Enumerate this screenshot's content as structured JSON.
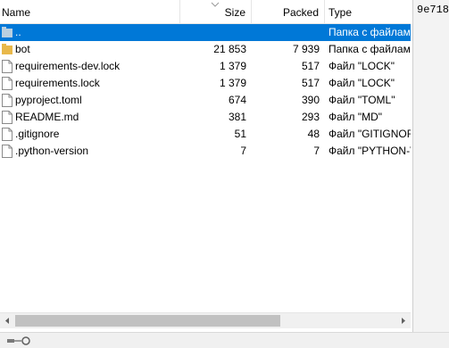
{
  "columns": {
    "name": "Name",
    "size": "Size",
    "packed": "Packed",
    "type": "Type"
  },
  "rows": [
    {
      "icon": "folder-up-icon",
      "name": "..",
      "size": "",
      "packed": "",
      "type": "Папка с файлами",
      "selected": true
    },
    {
      "icon": "folder-icon",
      "name": "bot",
      "size": "21 853",
      "packed": "7 939",
      "type": "Папка с файлами",
      "selected": false
    },
    {
      "icon": "file-icon",
      "name": "requirements-dev.lock",
      "size": "1 379",
      "packed": "517",
      "type": "Файл \"LOCK\"",
      "selected": false
    },
    {
      "icon": "file-icon",
      "name": "requirements.lock",
      "size": "1 379",
      "packed": "517",
      "type": "Файл \"LOCK\"",
      "selected": false
    },
    {
      "icon": "file-icon",
      "name": "pyproject.toml",
      "size": "674",
      "packed": "390",
      "type": "Файл \"TOML\"",
      "selected": false
    },
    {
      "icon": "file-icon",
      "name": "README.md",
      "size": "381",
      "packed": "293",
      "type": "Файл \"MD\"",
      "selected": false
    },
    {
      "icon": "file-icon",
      "name": ".gitignore",
      "size": "51",
      "packed": "48",
      "type": "Файл \"GITIGNORE\"",
      "selected": false
    },
    {
      "icon": "file-icon",
      "name": ".python-version",
      "size": "7",
      "packed": "7",
      "type": "Файл \"PYTHON-VERSION\"",
      "selected": false
    }
  ],
  "right_pane": {
    "text": "9e718"
  },
  "colors": {
    "selection": "#0078d7",
    "folder": "#e8b84a"
  }
}
